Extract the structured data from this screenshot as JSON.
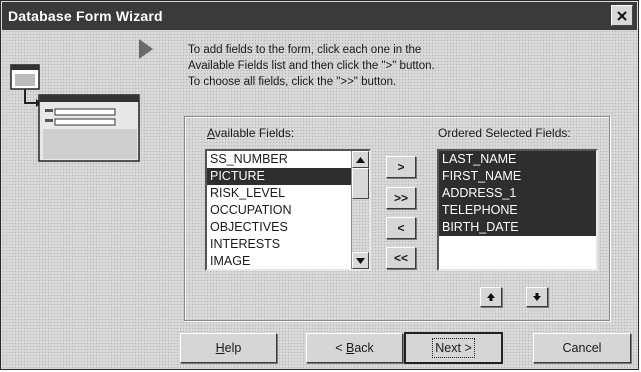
{
  "window": {
    "title": "Database Form Wizard"
  },
  "instructions": {
    "line1": "To add fields to the form, click each one in the",
    "line2": "Available Fields list and then click the \">\" button.",
    "line3": "To choose all fields, click the \">>\" button."
  },
  "available": {
    "label_prefix": "",
    "label_accel": "A",
    "label_rest": "vailable Fields:",
    "items": [
      "SS_NUMBER",
      "PICTURE",
      "RISK_LEVEL",
      "OCCUPATION",
      "OBJECTIVES",
      "INTERESTS",
      "IMAGE"
    ],
    "selected": "PICTURE"
  },
  "ordered": {
    "label": "Ordered Selected Fields:",
    "items": [
      "LAST_NAME",
      "FIRST_NAME",
      "ADDRESS_1",
      "TELEPHONE",
      "BIRTH_DATE"
    ]
  },
  "move_buttons": {
    "add_one": ">",
    "add_all": ">>",
    "remove_one": "<",
    "remove_all": "<<"
  },
  "order_buttons": {
    "up_icon": "arrow-up-icon",
    "down_icon": "arrow-down-icon"
  },
  "footer": {
    "help_accel": "H",
    "help_rest": "elp",
    "back_prefix": "< ",
    "back_accel": "B",
    "back_rest": "ack",
    "next_prefix": "Next ",
    "next_suffix": ">",
    "cancel": "Cancel"
  }
}
